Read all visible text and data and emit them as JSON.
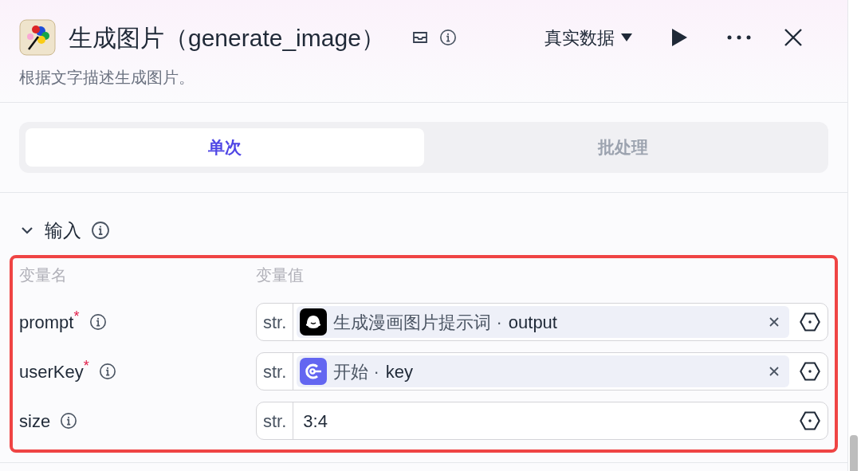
{
  "header": {
    "title": "生成图片（generate_image）",
    "description": "根据文字描述生成图片。",
    "data_source": "真实数据"
  },
  "tabs": [
    {
      "label": "单次",
      "selected": true
    },
    {
      "label": "批处理",
      "selected": false
    }
  ],
  "input_section": {
    "title": "输入",
    "expanded": true,
    "highlighted": true,
    "columns": [
      "变量名",
      "变量值"
    ],
    "rows": [
      {
        "name": "prompt",
        "required_mark": "*",
        "type": "str.",
        "kind": "reference",
        "node": {
          "kind": "ghost",
          "name": "生成漫画图片提示词 ·"
        },
        "field": "output"
      },
      {
        "name": "userKey",
        "required_mark": "*",
        "type": "str.",
        "kind": "reference",
        "node": {
          "kind": "start",
          "name": "开始 ·"
        },
        "field": "key"
      },
      {
        "name": "size",
        "type": "str.",
        "kind": "literal",
        "value": "3:4"
      }
    ]
  }
}
